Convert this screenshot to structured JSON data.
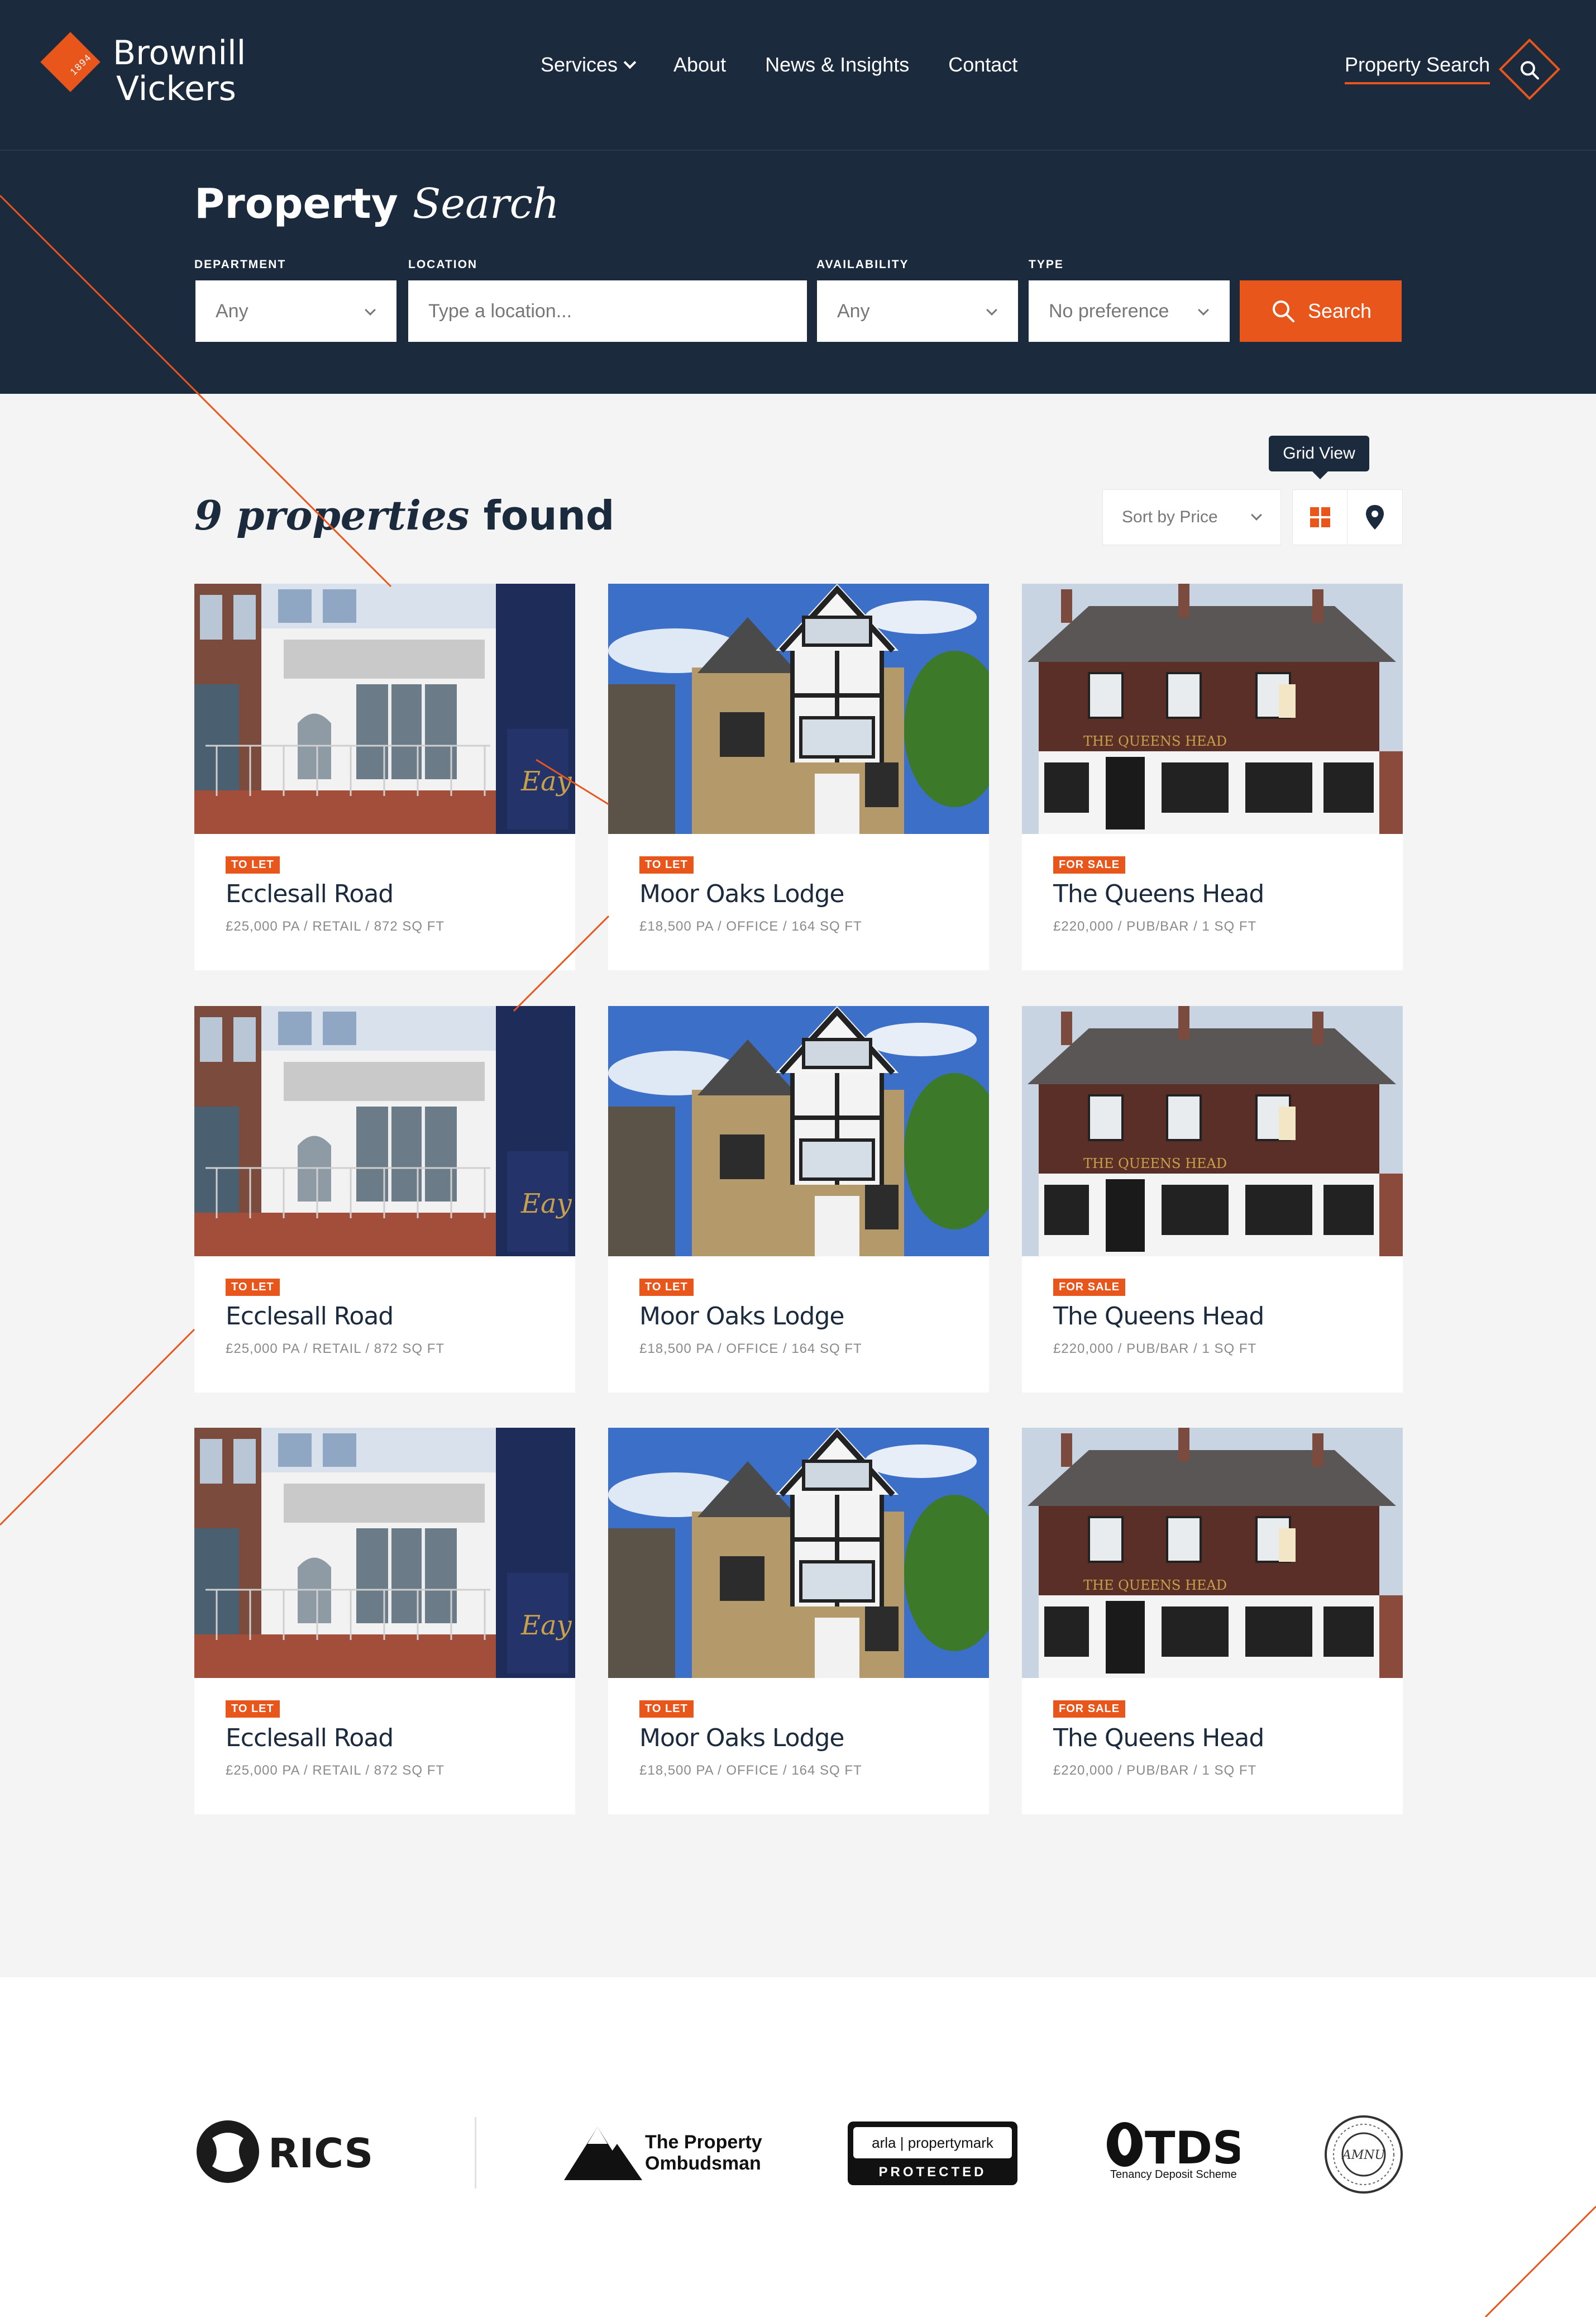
{
  "brand": {
    "name_line1": "Brownill",
    "name_line2": "Vickers",
    "year": "1894"
  },
  "nav": {
    "items": [
      {
        "label": "Services",
        "has_dropdown": true
      },
      {
        "label": "About"
      },
      {
        "label": "News & Insights"
      },
      {
        "label": "Contact"
      }
    ],
    "property_search": "Property Search"
  },
  "hero": {
    "title_plain": "Property",
    "title_italic": "Search",
    "fields": {
      "department": {
        "label": "DEPARTMENT",
        "value": "Any"
      },
      "location": {
        "label": "LOCATION",
        "placeholder": "Type a location..."
      },
      "availability": {
        "label": "AVAILABILITY",
        "value": "Any"
      },
      "type": {
        "label": "TYPE",
        "value": "No preference"
      }
    },
    "search_label": "Search"
  },
  "results": {
    "count_italic": "9 properties",
    "count_plain": "found",
    "sort_label": "Sort by Price",
    "tooltip": "Grid View"
  },
  "properties": [
    {
      "badge": "TO LET",
      "title": "Ecclesall Road",
      "meta": "£25,000 PA / RETAIL / 872 SQ FT",
      "image": "shopfront"
    },
    {
      "badge": "TO LET",
      "title": "Moor Oaks Lodge",
      "meta": "£18,500 PA / OFFICE / 164 SQ FT",
      "image": "lodge"
    },
    {
      "badge": "FOR SALE",
      "title": "The Queens Head",
      "meta": "£220,000 / PUB/BAR / 1 SQ FT",
      "image": "pub"
    },
    {
      "badge": "TO LET",
      "title": "Ecclesall Road",
      "meta": "£25,000 PA / RETAIL / 872 SQ FT",
      "image": "shopfront"
    },
    {
      "badge": "TO LET",
      "title": "Moor Oaks Lodge",
      "meta": "£18,500 PA / OFFICE / 164 SQ FT",
      "image": "lodge"
    },
    {
      "badge": "FOR SALE",
      "title": "The Queens Head",
      "meta": "£220,000 / PUB/BAR / 1 SQ FT",
      "image": "pub"
    },
    {
      "badge": "TO LET",
      "title": "Ecclesall Road",
      "meta": "£25,000 PA / RETAIL / 872 SQ FT",
      "image": "shopfront"
    },
    {
      "badge": "TO LET",
      "title": "Moor Oaks Lodge",
      "meta": "£18,500 PA / OFFICE / 164 SQ FT",
      "image": "lodge"
    },
    {
      "badge": "FOR SALE",
      "title": "The Queens Head",
      "meta": "£220,000 / PUB/BAR / 1 SQ FT",
      "image": "pub"
    }
  ],
  "footer_logos": {
    "rics": "RICS",
    "tpo_line1": "The Property",
    "tpo_line2": "Ombudsman",
    "arla_top": "arla | propertymark",
    "arla_bottom": "PROTECTED",
    "tds_main": "TDS",
    "tds_sub": "Tenancy Deposit Scheme",
    "ombudsman_badge": "AMNU"
  },
  "colors": {
    "navy": "#1b2a3c",
    "accent": "#e8561c",
    "page_bg": "#f4f4f4"
  }
}
